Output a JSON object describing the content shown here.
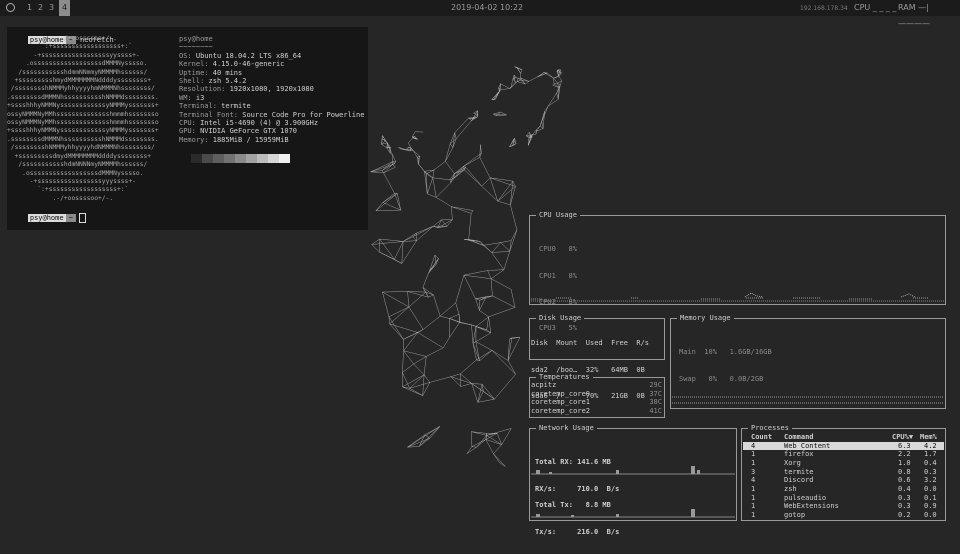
{
  "topbar": {
    "workspaces": [
      "1",
      "2",
      "3",
      "4"
    ],
    "active_workspace": "4",
    "clock": "2019-04-02  10:22",
    "ip": "192.168.178.34",
    "cpu_label": "CPU _ _ _ _",
    "ram_label": "RAM —|————"
  },
  "terminal": {
    "prompt_user": "psy@home",
    "command": "neofetch",
    "logo": [
      "             .-/+oossssoo+/-.",
      "         `:+ssssssssssssssssss+:`",
      "       -+ssssssssssssssssssyyssss+-",
      "     .ossssssssssssssssssdMMMNysssso.",
      "   /ssssssssssshdmmNNmmyNMMMMhssssss/",
      "  +ssssssssshmydMMMMMMMNddddyssssssss+",
      " /sssssssshNMMMyhhyyyyhmNMMMNhssssssss/",
      ".ssssssssdMMMNhsssssssssshNMMMdssssssss.",
      "+sssshhhyNMMNyssssssssssssyNMMMysssssss+",
      "ossyNMMMNyMMhsssssssssssssshmmmhssssssso",
      "ossyNMMMNyMMhsssssssssssssshmmmhssssssso",
      "+sssshhhyNMMNyssssssssssssyNMMMysssssss+",
      ".ssssssssdMMMNhsssssssssshNMMMdssssssss.",
      " /sssssssshNMMMyhhyyyyhdNMMMNhssssssss/",
      "  +sssssssssdmydMMMMMMMMddddyssssssss+",
      "   /ssssssssssshdmNNNNmyNMMMMhssssss/",
      "    .ossssssssssssssssssdMMMNysssso.",
      "      -+sssssssssssssssssyyyssss+-",
      "        `:+ssssssssssssssssss+:`",
      "            .-/+oossssoo+/-."
    ],
    "info": [
      {
        "key": "psy@home",
        "val": ""
      },
      {
        "key": "~~~~~~~~",
        "val": ""
      },
      {
        "key": "OS:",
        "val": " Ubuntu 18.04.2 LTS x86_64"
      },
      {
        "key": "Kernel:",
        "val": " 4.15.0-46-generic"
      },
      {
        "key": "Uptime:",
        "val": " 40 mins"
      },
      {
        "key": "Shell:",
        "val": " zsh 5.4.2"
      },
      {
        "key": "Resolution:",
        "val": " 1920x1080, 1920x1080"
      },
      {
        "key": "WM:",
        "val": " i3"
      },
      {
        "key": "Terminal:",
        "val": " termite"
      },
      {
        "key": "Terminal Font:",
        "val": " Source Code Pro for Powerline"
      },
      {
        "key": "CPU:",
        "val": " Intel i5-4690 (4) @ 3.900GHz"
      },
      {
        "key": "GPU:",
        "val": " NVIDIA GeForce GTX 1070"
      },
      {
        "key": "Memory:",
        "val": " 1885MiB / 15959MiB"
      }
    ],
    "swatch_colors": [
      "#2a2a2a",
      "#4a4a4a",
      "#5e5e5e",
      "#727272",
      "#8a8a8a",
      "#a2a2a2",
      "#bcbcbc",
      "#d6d6d6",
      "#f0f0f0"
    ]
  },
  "cpu": {
    "title": "CPU Usage",
    "cores": [
      "CPU0   8%",
      "CPU1   8%",
      "CPU2   8%",
      "CPU3   5%"
    ]
  },
  "disk": {
    "title": "Disk Usage",
    "header": "Disk  Mount  Used  Free  R/s",
    "rows": [
      "sda2  /boo…  32%   64MB  0B",
      "sda6  /      70%   21GB  0B"
    ]
  },
  "memory": {
    "title": "Memory Usage",
    "rows": [
      "Main  10%   1.6GB/16GB",
      "Swap   0%   0.0B/2GB"
    ]
  },
  "temps": {
    "title": "Temperatures",
    "rows": [
      {
        "name": "acpitz",
        "val": "29C"
      },
      {
        "name": "coretemp_core0",
        "val": "37C"
      },
      {
        "name": "coretemp_core1",
        "val": "38C"
      },
      {
        "name": "coretemp_core2",
        "val": "41C"
      }
    ]
  },
  "network": {
    "title": "Network Usage",
    "rx_total": "Total RX: 141.6 MB",
    "rx_rate": "RX/s:     710.0  B/s",
    "tx_total": "Total Tx:   8.8 MB",
    "tx_rate": "Tx/s:     216.0  B/s"
  },
  "processes": {
    "title": "Processes",
    "headers": {
      "count": "Count",
      "command": "Command",
      "cpu": "CPU%▼",
      "mem": "Mem%"
    },
    "rows": [
      {
        "count": "4",
        "command": "Web Content",
        "cpu": "6.3",
        "mem": "4.2"
      },
      {
        "count": "1",
        "command": "firefox",
        "cpu": "2.2",
        "mem": "1.7"
      },
      {
        "count": "1",
        "command": "Xorg",
        "cpu": "1.0",
        "mem": "0.4"
      },
      {
        "count": "3",
        "command": "termite",
        "cpu": "0.8",
        "mem": "0.3"
      },
      {
        "count": "4",
        "command": "Discord",
        "cpu": "0.6",
        "mem": "3.2"
      },
      {
        "count": "1",
        "command": "zsh",
        "cpu": "0.4",
        "mem": "0.0"
      },
      {
        "count": "1",
        "command": "pulseaudio",
        "cpu": "0.3",
        "mem": "0.1"
      },
      {
        "count": "1",
        "command": "WebExtensions",
        "cpu": "0.3",
        "mem": "0.9"
      },
      {
        "count": "1",
        "command": "gotop",
        "cpu": "0.2",
        "mem": "0.0"
      }
    ]
  },
  "wallpaper": {
    "subject": "low-poly deer head"
  }
}
